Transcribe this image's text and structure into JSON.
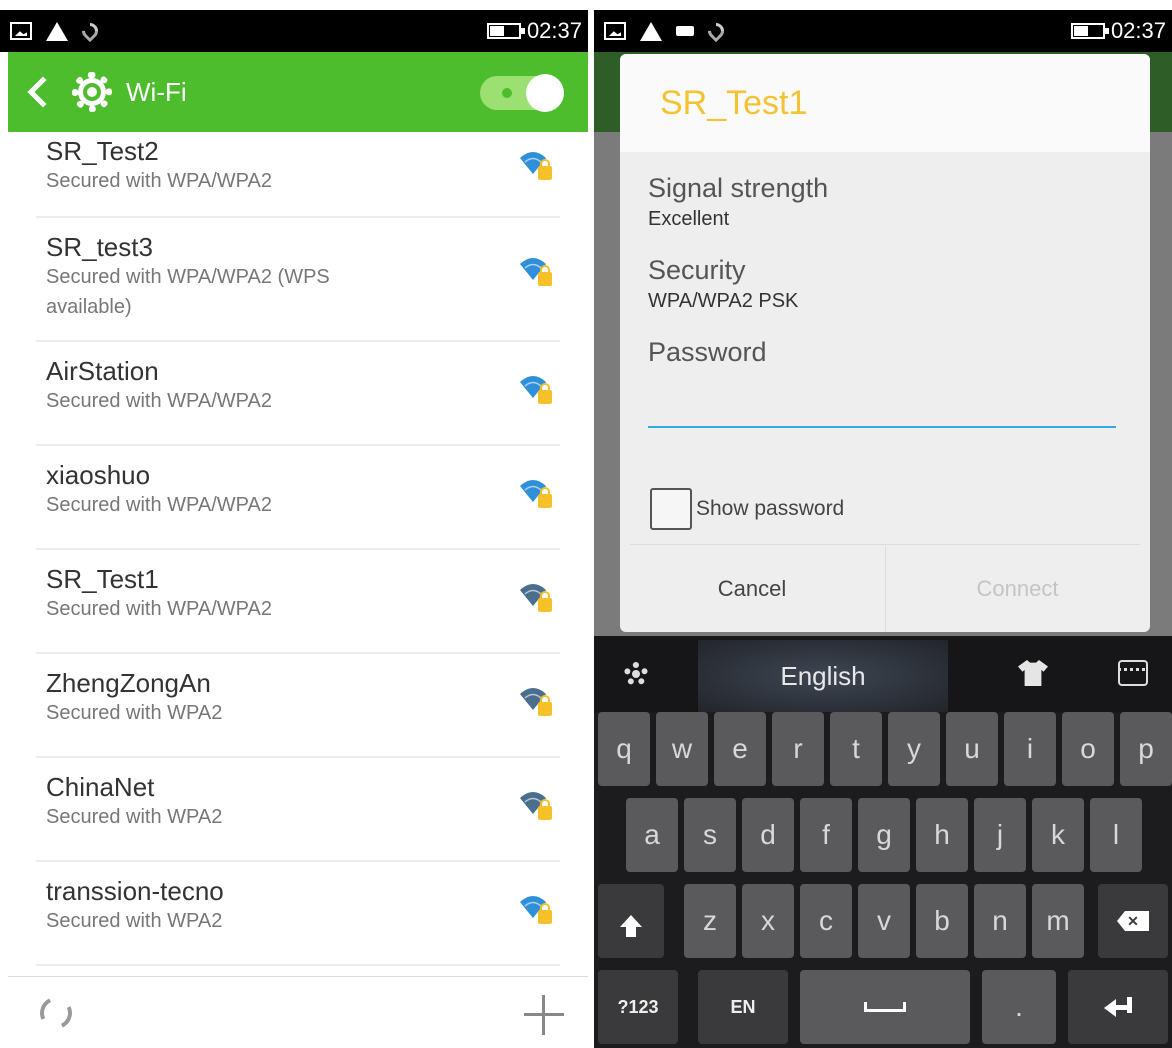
{
  "left": {
    "status": {
      "time": "02:37"
    },
    "appbar": {
      "title": "Wi-Fi"
    },
    "networks": [
      {
        "name": "SR_Test2",
        "security": "Secured with WPA/WPA2",
        "signal_color": "#2f8fd8"
      },
      {
        "name": "SR_test3",
        "security": "Secured with WPA/WPA2 (WPS available)",
        "signal_color": "#2f8fd8"
      },
      {
        "name": "AirStation",
        "security": "Secured with WPA/WPA2",
        "signal_color": "#2f8fd8"
      },
      {
        "name": "xiaoshuo",
        "security": "Secured with WPA/WPA2",
        "signal_color": "#2f8fd8"
      },
      {
        "name": "SR_Test1",
        "security": "Secured with WPA/WPA2",
        "signal_color": "#4a6e8c"
      },
      {
        "name": "ZhengZongAn",
        "security": "Secured with WPA2",
        "signal_color": "#4a6e8c"
      },
      {
        "name": "ChinaNet",
        "security": "Secured with WPA2",
        "signal_color": "#4a6e8c"
      },
      {
        "name": "transsion-tecno",
        "security": "Secured with WPA2",
        "signal_color": "#2f8fd8"
      }
    ]
  },
  "right": {
    "status": {
      "time": "02:37"
    },
    "dialog": {
      "title": "SR_Test1",
      "signal_label": "Signal strength",
      "signal_value": "Excellent",
      "security_label": "Security",
      "security_value": "WPA/WPA2 PSK",
      "password_label": "Password",
      "password_value": "",
      "show_password_label": "Show password",
      "cancel_label": "Cancel",
      "connect_label": "Connect"
    },
    "keyboard": {
      "language": "English",
      "row1": [
        "q",
        "w",
        "e",
        "r",
        "t",
        "y",
        "u",
        "i",
        "o",
        "p"
      ],
      "row2": [
        "a",
        "s",
        "d",
        "f",
        "g",
        "h",
        "j",
        "k",
        "l"
      ],
      "row3": [
        "z",
        "x",
        "c",
        "v",
        "b",
        "n",
        "m"
      ],
      "symbols_label": "?123",
      "lang_key_label": "EN",
      "period_label": "."
    }
  },
  "colors": {
    "accent_green": "#4dbd2e",
    "dialog_title": "#f4c233",
    "input_underline": "#36a9e1"
  }
}
